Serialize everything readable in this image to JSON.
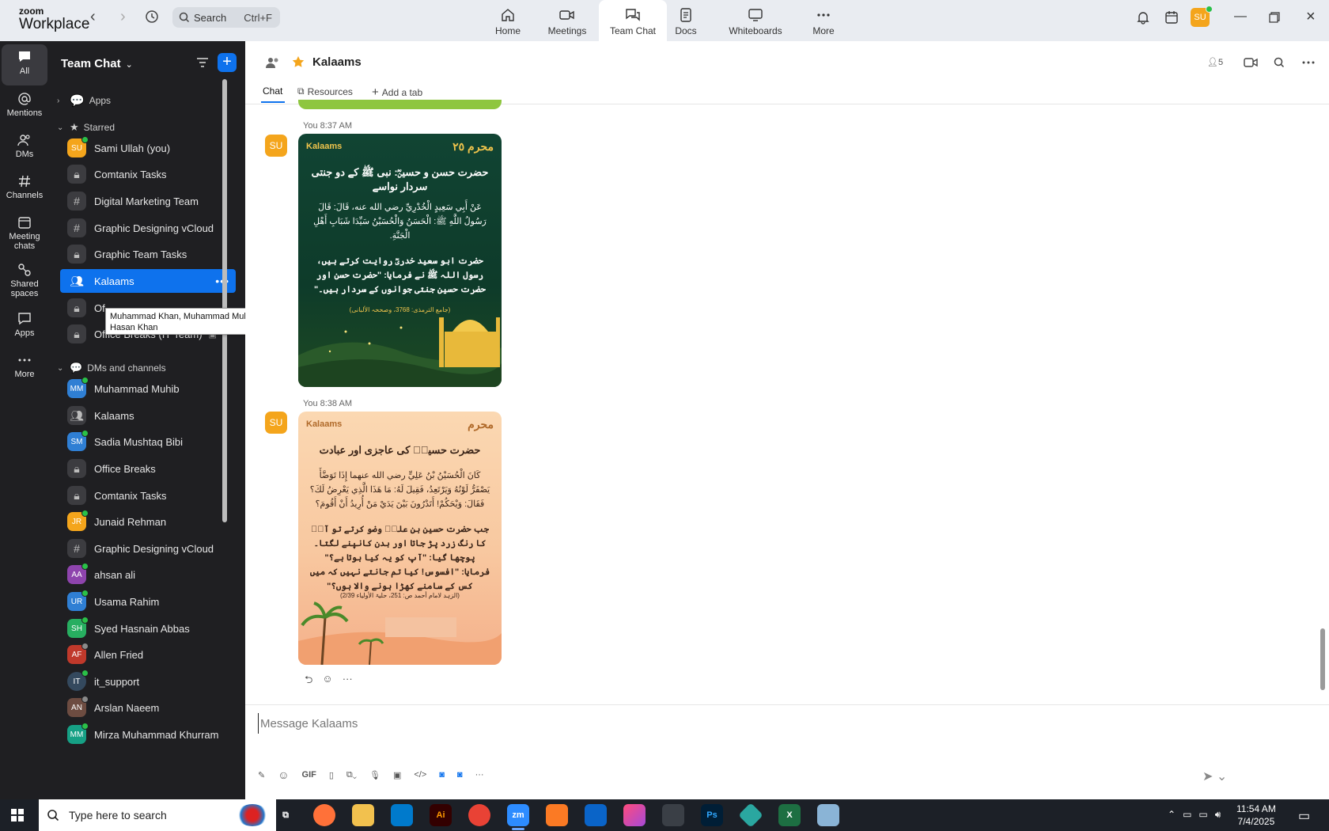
{
  "app": {
    "brand_line1": "zoom",
    "brand_line2": "Workplace"
  },
  "topbar": {
    "search_label": "Search",
    "search_shortcut": "Ctrl+F",
    "tabs": [
      {
        "label": "Home",
        "icon": "home-icon"
      },
      {
        "label": "Meetings",
        "icon": "video-icon"
      },
      {
        "label": "Team Chat",
        "icon": "chat-icon",
        "active": true
      },
      {
        "label": "Docs",
        "icon": "doc-icon"
      },
      {
        "label": "Whiteboards",
        "icon": "whiteboard-icon"
      },
      {
        "label": "More",
        "icon": "more-icon"
      }
    ],
    "avatar_initials": "SU"
  },
  "rail": [
    {
      "label": "All",
      "icon": "chat-bubble-icon",
      "active": true
    },
    {
      "label": "Mentions",
      "icon": "at-icon"
    },
    {
      "label": "DMs",
      "icon": "people-icon"
    },
    {
      "label": "Channels",
      "icon": "hash-icon"
    },
    {
      "label": "Meeting chats",
      "icon": "calendar-icon"
    },
    {
      "label": "Shared spaces",
      "icon": "shared-icon"
    },
    {
      "label": "Apps",
      "icon": "apps-icon"
    },
    {
      "label": "More",
      "icon": "more-icon"
    }
  ],
  "sidebar": {
    "title": "Team Chat",
    "sections": [
      {
        "label": "Apps",
        "collapsed": true
      },
      {
        "label": "Starred",
        "collapsed": false
      },
      {
        "label": "DMs and channels",
        "collapsed": false
      }
    ],
    "starred": [
      {
        "label": "Sami Ullah (you)",
        "type": "avatar",
        "initials": "SU",
        "color": "#f4a51c",
        "presence": "online"
      },
      {
        "label": "Comtanix Tasks",
        "type": "lock"
      },
      {
        "label": "Digital Marketing Team",
        "type": "hash"
      },
      {
        "label": "Graphic Designing vCloud",
        "type": "hash"
      },
      {
        "label": "Graphic Team Tasks",
        "type": "lock"
      },
      {
        "label": "Kalaams",
        "type": "group",
        "selected": true
      },
      {
        "label": "Of",
        "type": "lock"
      },
      {
        "label": "Office Breaks (IT Team)",
        "type": "lock"
      }
    ],
    "dms": [
      {
        "label": "Muhammad Muhib",
        "type": "avatar",
        "initials": "MM",
        "color": "#2f7fd4",
        "presence": "online"
      },
      {
        "label": "Kalaams",
        "type": "group"
      },
      {
        "label": "Sadia Mushtaq Bibi",
        "type": "avatar",
        "initials": "SM",
        "color": "#2f7fd4",
        "presence": "online"
      },
      {
        "label": "Office Breaks",
        "type": "lock"
      },
      {
        "label": "Comtanix Tasks",
        "type": "lock"
      },
      {
        "label": "Junaid Rehman",
        "type": "avatar",
        "initials": "JR",
        "color": "#f4a51c",
        "presence": "online"
      },
      {
        "label": "Graphic Designing vCloud",
        "type": "hash"
      },
      {
        "label": "ahsan ali",
        "type": "avatar",
        "initials": "AA",
        "color": "#8e44ad",
        "presence": "online"
      },
      {
        "label": "Usama Rahim",
        "type": "avatar",
        "initials": "UR",
        "color": "#2f7fd4",
        "presence": "online"
      },
      {
        "label": "Syed Hasnain Abbas",
        "type": "avatar",
        "initials": "SH",
        "color": "#27ae60",
        "presence": "online"
      },
      {
        "label": "Allen Fried",
        "type": "avatar",
        "initials": "AF",
        "color": "#c0392b",
        "presence": "away"
      },
      {
        "label": "it_support",
        "type": "avatar",
        "initials": "IT",
        "color": "#34495e",
        "presence": "online"
      },
      {
        "label": "Arslan Naeem",
        "type": "avatar",
        "initials": "AN",
        "color": "#6d4c41",
        "presence": "away"
      },
      {
        "label": "Mirza Muhammad Khurram",
        "type": "avatar",
        "initials": "MM",
        "color": "#16a085",
        "presence": "online"
      }
    ],
    "tooltip_line1": "Muhammad Khan, Muhammad Muhib, Junaid Rehman,",
    "tooltip_line2": "Hasan Khan"
  },
  "channel": {
    "name": "Kalaams",
    "tabs": [
      "Chat",
      "Resources",
      "Add a tab"
    ],
    "member_count": "5"
  },
  "messages": [
    {
      "avatar": "SU",
      "meta": "You 8:37 AM",
      "card": {
        "brand": "Kalaams",
        "brand2": "محرم ٢٥",
        "title": "حضرت حسن و حسینؓ: نبی ﷺ کے دو جنتی سردار نواسے",
        "arabic": "عَنْ أَبِي سَعِيدٍ الْخُدْرِيِّ رضي الله عنه، قَالَ: قَالَ رَسُولُ اللَّهِ ﷺ: الْحَسَنُ وَالْحُسَيْنُ سَيِّدَا شَبَابِ أَهْلِ الْجَنَّةِ.",
        "urdu": "حضرت ابو سعید خدریؓ روایت کرتے ہیں، رسول اللہ ﷺ نے فرمایا: \"حضرت حسن اور حضرت حسین جنتی جوانوں کے سردار ہیں۔\"",
        "ref": "(جامع الترمذی: 3768، وصححہ الألبانی)"
      }
    },
    {
      "avatar": "SU",
      "meta": "You 8:38 AM",
      "card": {
        "brand": "Kalaams",
        "brand2": "محرم",
        "title": "حضرت حسینؓ کی عاجزی اور عبادت",
        "arabic": "كَانَ الْحُسَيْنُ بْنُ عَلِيٍّ رضي الله عنهما إِذَا تَوَضَّأَ يَصْفَرُّ لَوْنُهُ وَيَرْتَعِدُ، فَقِيلَ لَهُ: مَا هَذَا الَّذِي يَعْرِضُ لَكَ؟ فَقَالَ: وَيْحَكُمْ! أَتَدْرُونَ بَيْنَ يَدَيْ مَنْ أُرِيدُ أَنْ أَقُومَ؟",
        "urdu": "جب حضرت حسین بن علیؓ وضو کرتے تو آپؓ کا رنگ زرد پڑ جاتا اور بدن کانپنے لگتا۔ پوچھا گیا: \"آپ کو یہ کیا ہوتا ہے؟\" فرمایا: \"افسوس! کیا تم جانتے نہیں کہ میں کس کے سامنے کھڑا ہونے والا ہوں؟\"",
        "ref": "(الزہد لامام أحمد ص: 251، حلیۃ الأولیاء 2/39)"
      }
    }
  ],
  "composer": {
    "placeholder": "Message Kalaams",
    "gif_label": "GIF"
  },
  "taskbar": {
    "search_placeholder": "Type here to search",
    "time": "11:54 AM",
    "date": "7/4/2025",
    "zoom_app_label": "zm",
    "illustrator_label": "Ai",
    "photoshop_label": "Ps",
    "excel_label": "X"
  }
}
